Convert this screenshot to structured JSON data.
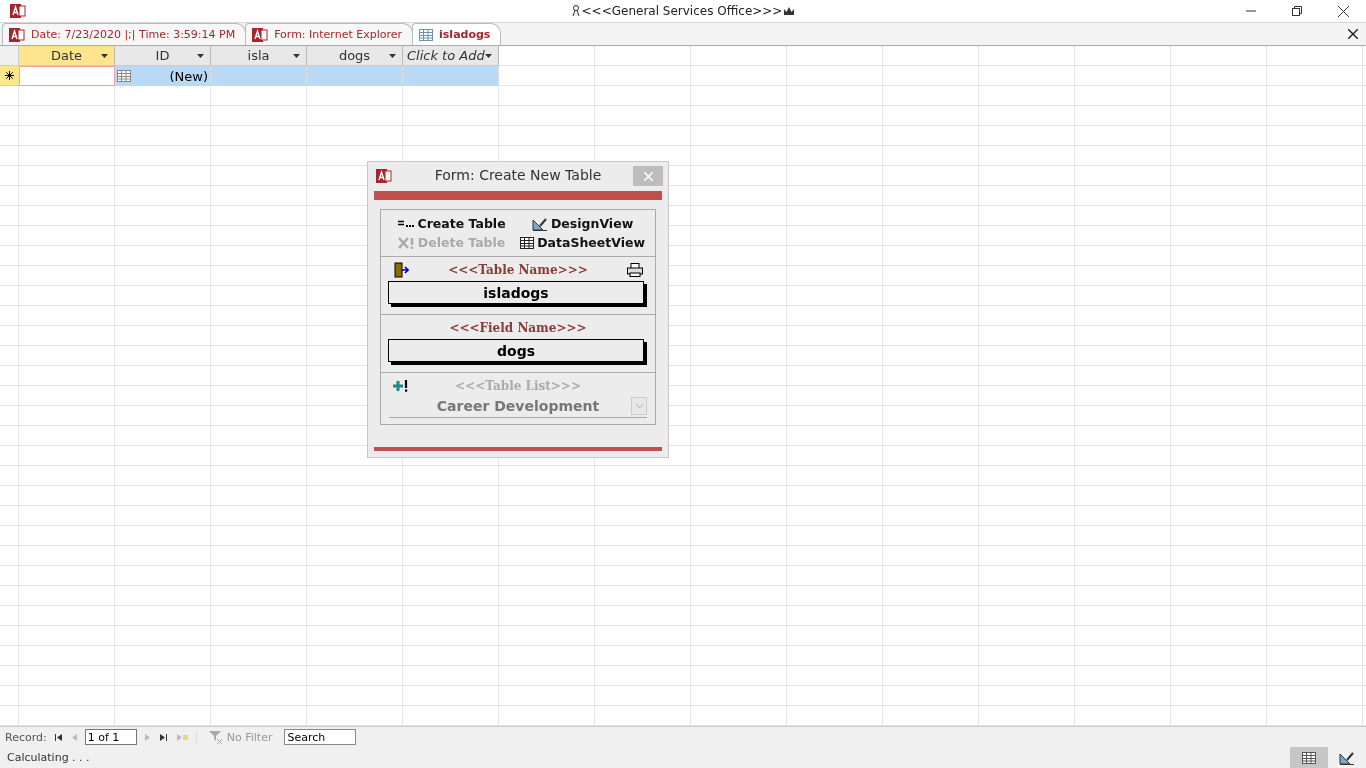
{
  "window": {
    "title": "<<<General Services Office>>>"
  },
  "tabs": [
    {
      "label": "Date: 7/23/2020 |;| Time: 3:59:14 PM",
      "kind": "form",
      "selected": false
    },
    {
      "label": "Form: Internet Explorer",
      "kind": "form",
      "selected": false
    },
    {
      "label": "isladogs",
      "kind": "table",
      "selected": true
    }
  ],
  "datasheet": {
    "columns": [
      {
        "label": "Date",
        "kind": "field",
        "selected": true
      },
      {
        "label": "ID",
        "kind": "field",
        "selected": false
      },
      {
        "label": "isla",
        "kind": "field",
        "selected": false
      },
      {
        "label": "dogs",
        "kind": "field",
        "selected": false
      },
      {
        "label": "Click to Add",
        "kind": "add",
        "selected": false
      }
    ],
    "new_row": {
      "id_value": "(New)",
      "selected": true
    }
  },
  "dialog": {
    "title": "Form: Create New Table",
    "buttons": [
      {
        "label": "Create Table",
        "kind": "create",
        "disabled": false
      },
      {
        "label": "DesignView",
        "kind": "design",
        "disabled": false
      },
      {
        "label": "Delete Table",
        "kind": "delete",
        "disabled": true
      },
      {
        "label": "DataSheetView",
        "kind": "datasheet",
        "disabled": false
      }
    ],
    "table_name": {
      "label": "<<<Table Name>>>",
      "value": "isladogs"
    },
    "field_name": {
      "label": "<<<Field Name>>>",
      "value": "dogs"
    },
    "table_list": {
      "label": "<<<Table List>>>",
      "value": "Career Development",
      "disabled": true
    }
  },
  "record_nav": {
    "label": "Record:",
    "position": "1 of 1",
    "filter": "No Filter",
    "search": "Search"
  },
  "status_bar": {
    "text": "Calculating . . .",
    "views": [
      {
        "kind": "datasheet",
        "selected": true
      },
      {
        "kind": "design",
        "selected": false
      }
    ]
  }
}
